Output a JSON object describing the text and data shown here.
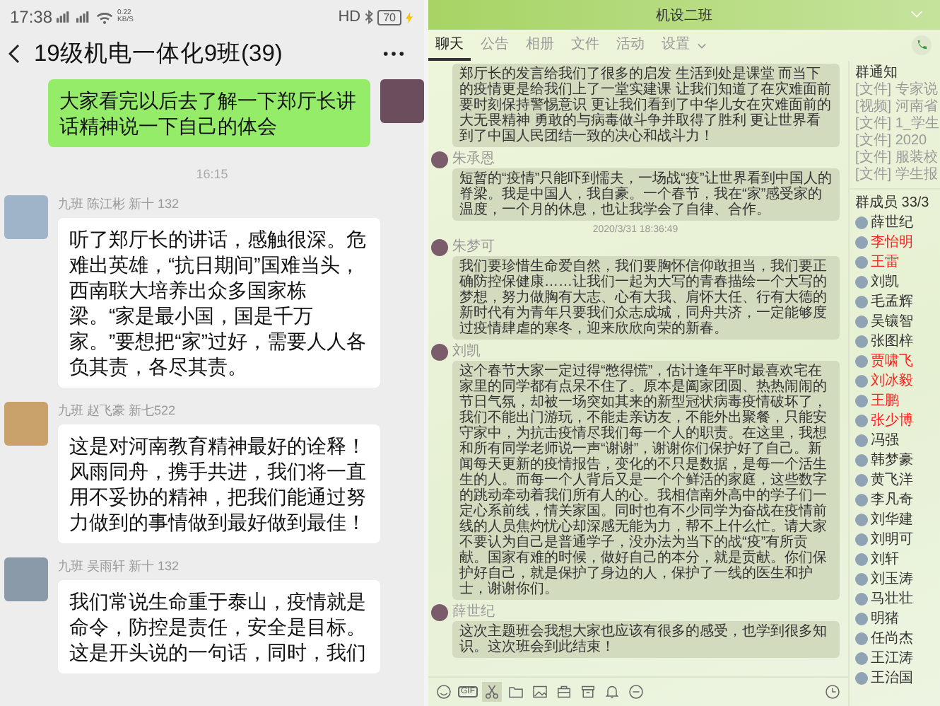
{
  "phone": {
    "status_bar": {
      "time": "17:38",
      "speed": "0.22 KB/S",
      "network": "HD",
      "battery": "70"
    },
    "title": "19级机电一体化9班(39)",
    "messages": [
      {
        "kind": "own",
        "text": "大家看完以后去了解一下郑厅长讲话精神说一下自己的体会"
      },
      {
        "kind": "time",
        "text": "16:15"
      },
      {
        "kind": "other",
        "sender": "九班 陈江彬 新十 132",
        "text": "听了郑厅长的讲话，感触很深。危难出英雄，“抗日期间”国难当头，西南联大培养出众多国家栋梁。“家是最小国，国是千万家。”要想把“家”过好，需要人人各负其责，各尽其责。"
      },
      {
        "kind": "other",
        "sender": "九班  赵飞豪 新七522",
        "text": "这是对河南教育精神最好的诠释！风雨同舟，携手共进，我们将一直用不妥协的精神，把我们能通过努力做到的事情做到最好做到最佳！"
      },
      {
        "kind": "other",
        "sender": "九班 吴雨轩 新十 132",
        "text": "我们常说生命重于泰山，疫情就是命令，防控是责任，安全是目标。这是开头说的一句话，同时，我们"
      }
    ]
  },
  "window": {
    "title": "机设二班",
    "tabs": [
      {
        "label": "聊天",
        "selected": true
      },
      {
        "label": "公告",
        "selected": false
      },
      {
        "label": "相册",
        "selected": false
      },
      {
        "label": "文件",
        "selected": false
      },
      {
        "label": "活动",
        "selected": false
      },
      {
        "label": "设置",
        "selected": false
      }
    ],
    "messages": [
      {
        "kind": "message",
        "text": "郑厅长的发言给我们了很多的启发 生活到处是课堂 而当下的疫情更是给我们上了一堂实建课 让我们知道了在灾难面前要时刻保持警惕意识 更让我们看到了中华儿女在灾难面前的大无畏精神 勇敢的与病毒做斗争并取得了胜利 更让世界看到了中国人民团结一致的决心和战斗力！"
      },
      {
        "kind": "message",
        "sender": "朱承恩",
        "text": "短暂的“疫情”只能吓到懦夫，一场战“疫”让世界看到中国人的脊梁。我是中国人，我自豪。一个春节，我在“家”感受家的温度，一个月的休息，也让我学会了自律、合作。"
      },
      {
        "kind": "time",
        "text": "2020/3/31 18:36:49"
      },
      {
        "kind": "message",
        "sender": "朱梦可",
        "text": "我们要珍惜生命爱自然，我们要胸怀信仰敢担当，我们要正确防控保健康……让我们一起为大写的青春描绘一个大写的梦想，努力做胸有大志、心有大我、肩怀大任、行有大德的新时代有为青年只要我们众志成城，同舟共济，一定能够度过疫情肆虐的寒冬，迎来欣欣向荣的新春。"
      },
      {
        "kind": "message",
        "sender": "刘凯",
        "text": "这个春节大家一定过得“憋得慌”，估计逢年平时最喜欢宅在家里的同学都有点呆不住了。原本是阖家团圆、热热闹闹的节日气氛，却被一场突如其来的新型冠状病毒疫情破坏了，我们不能出门游玩，不能走亲访友，不能外出聚餐，只能安守家中，为抗击疫情尽我们每一个人的职责。在这里，我想和所有同学老师说一声“谢谢”，谢谢你们保护好了自己。新闻每天更新的疫情报告，变化的不只是数据，是每一个活生生的人。而每一个人背后又是一个个鲜活的家庭，这些数字的跳动牵动着我们所有人的心。我相信南外高中的学子们一定心系前线，情关家国。同时也有不少同学为奋战在疫情前线的人员焦灼忧心却深感无能为力，帮不上什么忙。请大家不要认为自己是普通学子，没办法为当下的战“疫”有所贡献。国家有难的时候，做好自己的本分，就是贡献。你们保护好自己，就是保护了身边的人，保护了一线的医生和护士，谢谢你们。"
      },
      {
        "kind": "message",
        "sender": "薛世纪",
        "text": "这次主题班会我想大家也应该有很多的感受，也学到很多知识。这次班会到此结束！"
      }
    ],
    "toolbar": [
      {
        "kind": "emoji"
      },
      {
        "kind": "gif",
        "label": "GIF"
      },
      {
        "kind": "scissors",
        "selected": true
      },
      {
        "kind": "folder"
      },
      {
        "kind": "image"
      },
      {
        "kind": "bag"
      },
      {
        "kind": "box"
      },
      {
        "kind": "bell"
      },
      {
        "kind": "minus"
      }
    ],
    "notice_title": "群通知",
    "notices": [
      "[文件] 专家说",
      "[视频] 河南省",
      "[文件] 1_学生",
      "[文件] 2020",
      "[文件] 服装校",
      "[文件] 学生报"
    ],
    "members_title": "群成员 33/3",
    "members": [
      {
        "name": "薛世纪",
        "color": "#333333"
      },
      {
        "name": "李怡明",
        "color": "#ff2020"
      },
      {
        "name": "王雷",
        "color": "#ff2020"
      },
      {
        "name": "刘凯",
        "color": "#333333"
      },
      {
        "name": "毛孟辉",
        "color": "#333333"
      },
      {
        "name": "吴镶智",
        "color": "#333333"
      },
      {
        "name": "张图梓",
        "color": "#333333"
      },
      {
        "name": "贾啸飞",
        "color": "#ff2020"
      },
      {
        "name": "刘冰毅",
        "color": "#ff2020"
      },
      {
        "name": "王鹏",
        "color": "#ff2020"
      },
      {
        "name": "张少博",
        "color": "#ff2020"
      },
      {
        "name": "冯强",
        "color": "#333333"
      },
      {
        "name": "韩梦豪",
        "color": "#333333"
      },
      {
        "name": "黄飞洋",
        "color": "#333333"
      },
      {
        "name": "李凡奇",
        "color": "#333333"
      },
      {
        "name": "刘华建",
        "color": "#333333"
      },
      {
        "name": "刘明可",
        "color": "#333333"
      },
      {
        "name": "刘轩",
        "color": "#333333"
      },
      {
        "name": "刘玉涛",
        "color": "#333333"
      },
      {
        "name": "马壮壮",
        "color": "#333333"
      },
      {
        "name": "明猪",
        "color": "#333333"
      },
      {
        "name": "任尚杰",
        "color": "#333333"
      },
      {
        "name": "王江涛",
        "color": "#333333"
      },
      {
        "name": "王治国",
        "color": "#333333"
      }
    ]
  }
}
